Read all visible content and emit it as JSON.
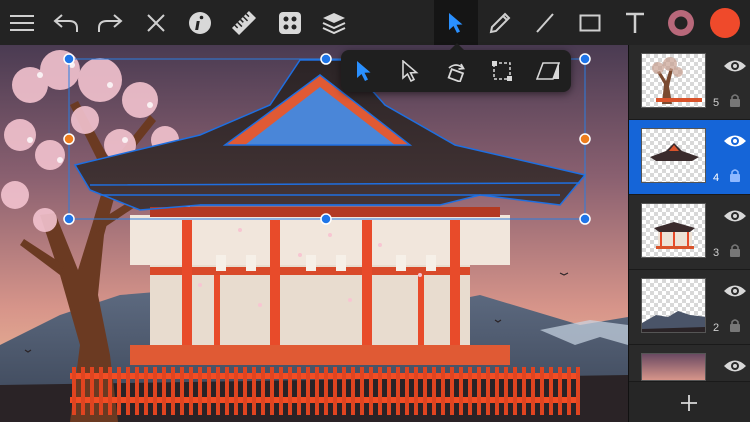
{
  "toolbar": {
    "left_tools": [
      "menu-icon",
      "undo-icon",
      "redo-icon",
      "close-icon",
      "info-icon",
      "ruler-icon",
      "grid-icon",
      "layers-icon"
    ],
    "right_tools": [
      "select-arrow-icon",
      "pencil-icon",
      "line-icon",
      "rectangle-icon",
      "text-icon"
    ],
    "active_tool": "select-arrow-icon",
    "stroke_color": "#b8687a",
    "fill_color": "#ef4a2b"
  },
  "selection_popup": {
    "tools": [
      "select-icon",
      "direct-select-icon",
      "rotate-icon",
      "crop-icon",
      "skew-icon"
    ]
  },
  "layers": {
    "items": [
      {
        "number": "5",
        "name": "tree-layer",
        "selected": false,
        "visible": true,
        "locked": true
      },
      {
        "number": "4",
        "name": "roof-layer",
        "selected": true,
        "visible": true,
        "locked": true
      },
      {
        "number": "3",
        "name": "temple-layer",
        "selected": false,
        "visible": true,
        "locked": true
      },
      {
        "number": "2",
        "name": "mountains-layer",
        "selected": false,
        "visible": true,
        "locked": true
      },
      {
        "number": "1",
        "name": "sky-layer",
        "selected": false,
        "visible": true,
        "locked": false
      }
    ],
    "add_button": "plus-icon"
  },
  "colors": {
    "accent": "#1a73e8",
    "selection": "#2a7de1",
    "handle_orange": "#ee7d1c",
    "panel_bg": "#2a2a2a",
    "toolbar_bg": "#232323"
  }
}
